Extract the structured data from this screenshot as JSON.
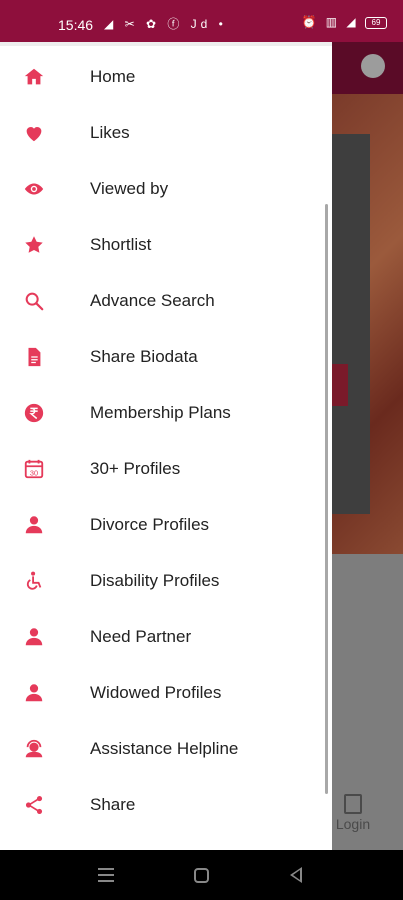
{
  "status_bar": {
    "time": "15:46",
    "left_icons": "◢ ✂ ✿ ⓕ Jd •",
    "right_icons": "⏰ ▥ ◢",
    "battery": "69"
  },
  "drawer": {
    "accent": "#e53a5a",
    "items": [
      {
        "label": "Home",
        "icon": "home-icon"
      },
      {
        "label": "Likes",
        "icon": "heart-icon"
      },
      {
        "label": "Viewed by",
        "icon": "eye-icon"
      },
      {
        "label": "Shortlist",
        "icon": "star-icon"
      },
      {
        "label": "Advance Search",
        "icon": "search-icon"
      },
      {
        "label": "Share Biodata",
        "icon": "document-icon"
      },
      {
        "label": "Membership Plans",
        "icon": "rupee-icon"
      },
      {
        "label": "30+ Profiles",
        "icon": "calendar-icon"
      },
      {
        "label": "Divorce Profiles",
        "icon": "person-icon"
      },
      {
        "label": "Disability Profiles",
        "icon": "wheelchair-icon"
      },
      {
        "label": "Need Partner",
        "icon": "person-icon"
      },
      {
        "label": "Widowed Profiles",
        "icon": "person-icon"
      },
      {
        "label": "Assistance Helpline",
        "icon": "support-agent-icon"
      },
      {
        "label": "Share",
        "icon": "share-icon"
      }
    ]
  },
  "background_app": {
    "login_label": "Login"
  }
}
